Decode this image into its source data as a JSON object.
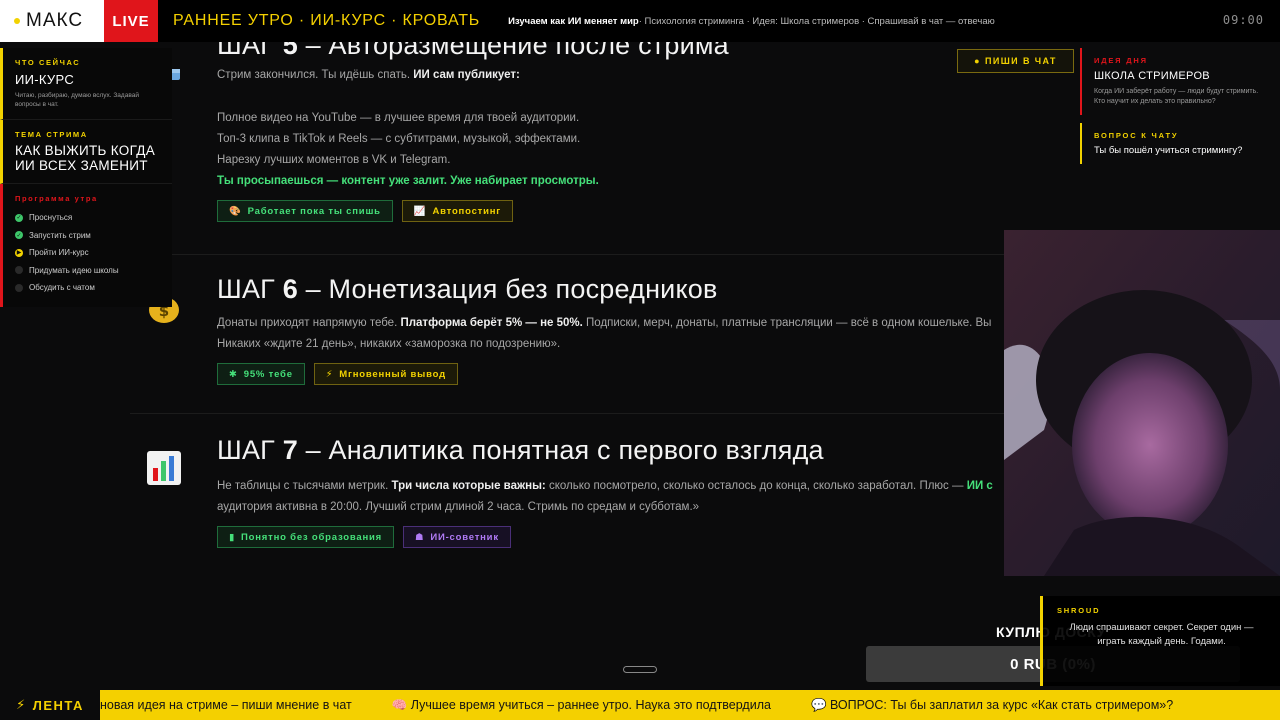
{
  "topbar": {
    "brand": "МАКС",
    "live": "LIVE",
    "show_title": "РАННЕЕ УТРО · ИИ-КУРС · КРОВАТЬ",
    "ticker_highlight": "Изучаем как ИИ меняет мир",
    "ticker_rest": " · Психология стриминга · Идея: Школа стримеров · Спрашивай в чат — отвечаю",
    "clock": "09:00"
  },
  "left_panel": {
    "now_kicker": "ЧТО СЕЙЧАС",
    "now_title": "ИИ-КУРС",
    "now_sub": "Читаю, разбираю, думаю вслух. Задавай вопросы в чат.",
    "topic_kicker": "ТЕМА СТРИМА",
    "topic_title": "КАК ВЫЖИТЬ КОГДА ИИ ВСЕХ ЗАМЕНИТ",
    "program_kicker": "Программа утра",
    "program": [
      {
        "label": "Проснуться",
        "state": "done"
      },
      {
        "label": "Запустить стрим",
        "state": "done"
      },
      {
        "label": "Пройти ИИ-курс",
        "state": "now"
      },
      {
        "label": "Придумать идею школы",
        "state": "todo"
      },
      {
        "label": "Обсудить с чатом",
        "state": "todo"
      }
    ]
  },
  "write_chat": "ПИШИ В ЧАТ",
  "steps": {
    "s5": {
      "prefix": "ШАГ ",
      "num": "5",
      "title": " – Авторазмещение после стрима",
      "intro_plain": "Стрим закончился. Ты идёшь спать. ",
      "intro_bold": "ИИ сам публикует:",
      "line1": "Полное видео на YouTube — в лучшее время для твоей аудитории.",
      "line2": "Топ-3 клипа в TikTok и Reels — с субтитрами, музыкой, эффектами.",
      "line3": "Нарезку лучших моментов в VK и Telegram.",
      "line4": "Ты просыпаешься — контент уже залит. Уже набирает просмотры.",
      "tag1": "Работает пока ты спишь",
      "tag2": "Автопостинг"
    },
    "s6": {
      "prefix": "ШАГ ",
      "num": "6",
      "title": " – Монетизация без посредников",
      "p1_plain": "Донаты приходят напрямую тебе. ",
      "p1_bold": "Платформа берёт 5% — не 50%.",
      "p1_rest": " Подписки, мерч, донаты, платные трансляции — всё в одном кошельке. Вы",
      "p2": "Никаких «ждите 21 день», никаких «заморозка по подозрению».",
      "tag1": "95% тебе",
      "tag2": "Мгновенный вывод"
    },
    "s7": {
      "prefix": "ШАГ ",
      "num": "7",
      "title": " – Аналитика понятная с первого взгляда",
      "p1_plain": "Не таблицы с тысячами метрик. ",
      "p1_bold": "Три числа которые важны:",
      "p1_rest": " сколько посмотрело, сколько осталось до конца, сколько заработал. Плюс — ",
      "p1_green": "ИИ с",
      "p2": "аудитория активна в 20:00. Лучший стрим длиной 2 часа. Стримь по средам и субботам.»",
      "tag1": "Понятно без образования",
      "tag2": "ИИ-советник"
    }
  },
  "right_panel": {
    "idea_kicker": "ИДЕЯ ДНЯ",
    "idea_title": "ШКОЛА СТРИМЕРОВ",
    "idea_sub": "Когда ИИ заберёт работу — люди будут стримить. Кто научит их делать это правильно?",
    "q_kicker": "ВОПРОС К ЧАТУ",
    "q_text": "Ты бы пошёл учиться стримингу?"
  },
  "donation": {
    "label": "КУПЛЮ ДОСКУ",
    "amount": "0 RUB (0%)"
  },
  "chat_message": {
    "user": "SHROUD",
    "text": "Люди спрашивают секрет. Секрет один — играть каждый день. Годами."
  },
  "bottom_ticker": {
    "label": "ЛЕНТА",
    "items": [
      "новая идея на стриме – пиши мнение в чат",
      "🧠 Лучшее время учиться – раннее утро. Наука это подтвердила",
      "💬 ВОПРОС: Ты бы заплатил за курс «Как стать стримером»?"
    ]
  },
  "colors": {
    "accent_yellow": "#f4d000",
    "live_red": "#e0151b",
    "success_green": "#45e07a",
    "purple": "#b07af5"
  }
}
